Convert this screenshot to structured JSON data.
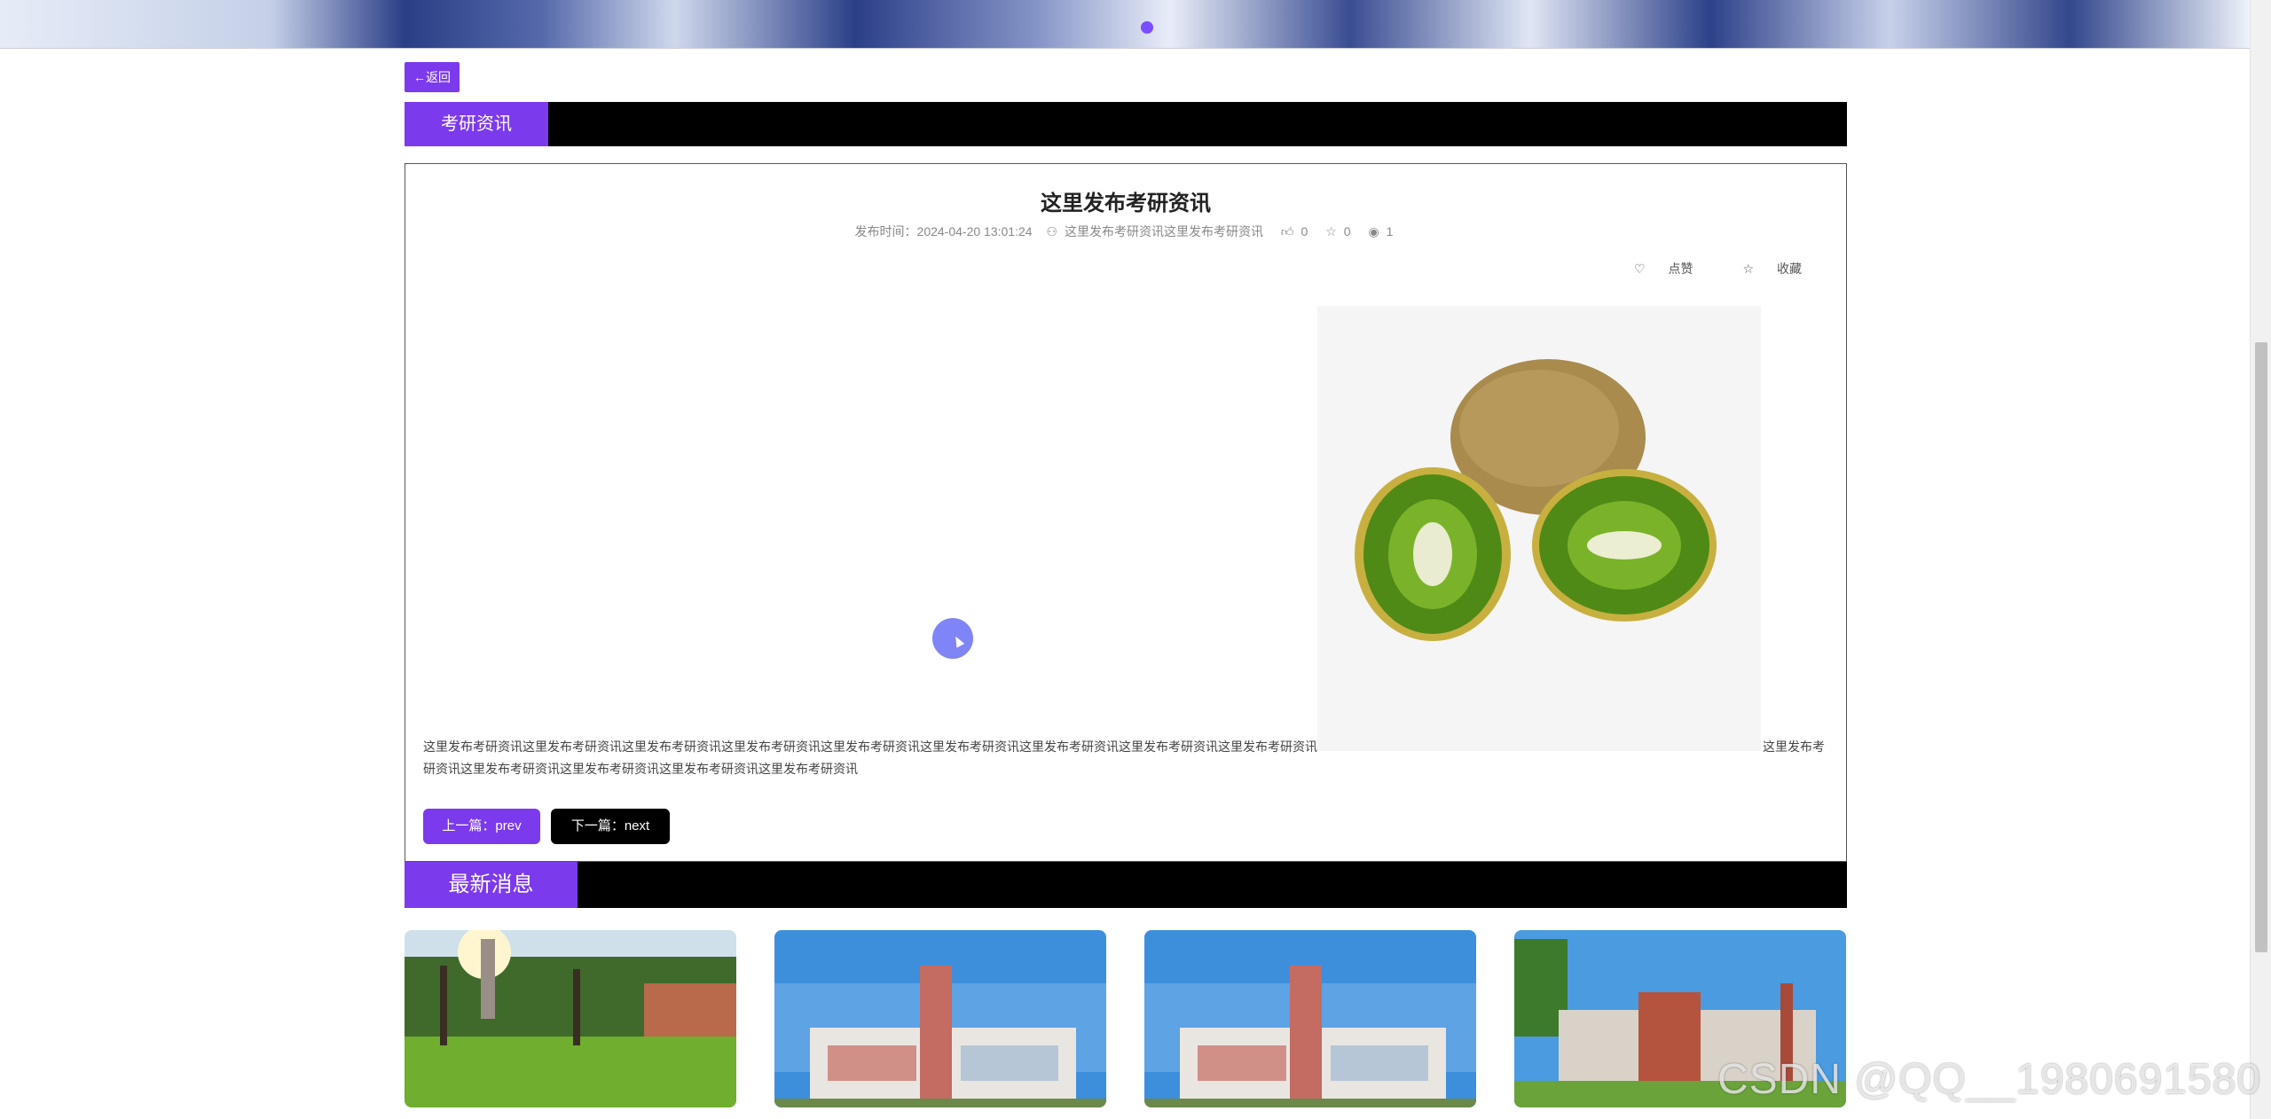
{
  "nav": {
    "back_label": "←返回"
  },
  "section": {
    "title": "考研资讯"
  },
  "article": {
    "title": "这里发布考研资讯",
    "publish_time": "发布时间：2024-04-20 13:01:24",
    "author": "这里发布考研资讯这里发布考研资讯",
    "likes": "0",
    "favorites": "0",
    "views": "1",
    "like_label": "点赞",
    "favorite_label": "收藏",
    "content_line1": "这里发布考研资讯这里发布考研资讯这里发布考研资讯这里发布考研资讯这里发布考研资讯这里发布考研资讯这里发布考研资讯这里发布考研资讯这里发布考研资讯",
    "content_line1_right": "这里发布考",
    "content_line2": "研资讯这里发布考研资讯这里发布考研资讯这里发布考研资讯这里发布考研资讯",
    "prev_label": "上一篇：prev",
    "next_label": "下一篇：next"
  },
  "latest": {
    "title": "最新消息"
  },
  "watermark": "CSDN @QQ__1980691580",
  "colors": {
    "accent": "#7c3aed",
    "bar": "#000000"
  }
}
